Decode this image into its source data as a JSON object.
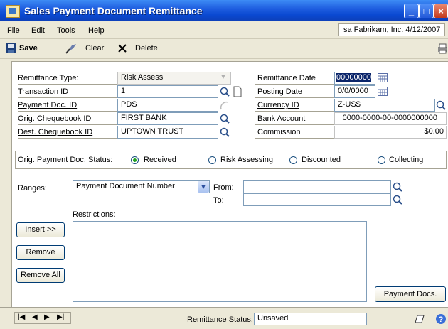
{
  "window": {
    "title": "Sales Payment Document Remittance"
  },
  "menu": {
    "items": [
      "File",
      "Edit",
      "Tools",
      "Help"
    ],
    "company_info": "sa  Fabrikam, Inc.  4/12/2007"
  },
  "toolbar": {
    "save": "Save",
    "clear": "Clear",
    "delete": "Delete"
  },
  "form": {
    "remittance_type_label": "Remittance Type:",
    "remittance_type_value": "Risk Assess",
    "transaction_id_label": "Transaction ID",
    "transaction_id_value": "1",
    "payment_doc_id_label": "Payment Doc. ID",
    "payment_doc_id_value": "PDS",
    "orig_chequebook_label": "Orig. Chequebook ID",
    "orig_chequebook_value": "FIRST BANK",
    "dest_chequebook_label": "Dest. Chequebook ID",
    "dest_chequebook_value": "UPTOWN TRUST",
    "remittance_date_label": "Remittance Date",
    "remittance_date_value": "00000000",
    "posting_date_label": "Posting Date",
    "posting_date_value": "0/0/0000",
    "currency_id_label": "Currency ID",
    "currency_id_value": "Z-US$",
    "bank_account_label": "Bank Account",
    "bank_account_value": "0000-0000-00-0000000000",
    "commission_label": "Commission",
    "commission_value": "$0.00"
  },
  "status_options": {
    "label": "Orig. Payment Doc. Status:",
    "options": [
      "Received",
      "Risk Assessing",
      "Discounted",
      "Collecting"
    ],
    "selected": "Received"
  },
  "ranges": {
    "label": "Ranges:",
    "selected": "Payment Document Number",
    "from_label": "From:",
    "to_label": "To:",
    "from_value": "",
    "to_value": "",
    "restrictions_label": "Restrictions:"
  },
  "buttons": {
    "insert": "Insert >>",
    "remove": "Remove",
    "remove_all": "Remove All",
    "payment_docs": "Payment Docs."
  },
  "status_bar": {
    "remittance_status_label": "Remittance Status:",
    "remittance_status_value": "Unsaved"
  },
  "colors": {
    "title_bar": "#0a49d1",
    "window_bg": "#ece9d8",
    "field_border": "#7f9db9"
  }
}
